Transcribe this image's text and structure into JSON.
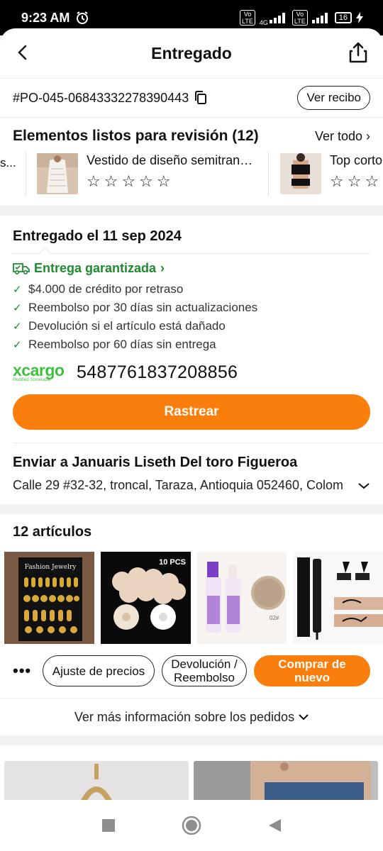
{
  "status_bar": {
    "time": "9:23 AM",
    "network": "4G",
    "lte_label": "Vo LTE",
    "battery": "16"
  },
  "header": {
    "title": "Entregado"
  },
  "order": {
    "id": "#PO-045-06843332278390443",
    "receipt_label": "Ver recibo"
  },
  "review": {
    "title": "Elementos listos para revisión (12)",
    "see_all": "Ver todo",
    "items": [
      {
        "name": "Vestido de diseño semitran…"
      },
      {
        "name": "Top corto"
      }
    ],
    "partial_left": "s..."
  },
  "delivery": {
    "title": "Entregado el 11 sep 2024",
    "guarantee": "Entrega garantizada",
    "benefits": [
      "$4.000 de crédito por retraso",
      "Reembolso por 30 días sin actualizaciones",
      "Devolución si el artículo está dañado",
      "Reembolso por 60 días sin entrega"
    ],
    "carrier_logo": "xcargo",
    "carrier_sub": "Modified Somerable",
    "tracking_number": "5487761837208856",
    "track_button": "Rastrear"
  },
  "shipping": {
    "title": "Enviar a Januaris Liseth Del toro Figueroa",
    "address": "Calle 29 #32-32, troncal, Taraza, Antioquia 052460, Colom"
  },
  "items": {
    "title": "12 artículos",
    "thumb_labels": [
      "Fashion Jewelry",
      "10 PCS"
    ],
    "actions": {
      "more": "•••",
      "price_adjust": "Ajuste de precios",
      "return_refund": "Devolución / Reembolso",
      "buy_again": "Comprar de nuevo"
    },
    "more_info": "Ver más información sobre los pedidos"
  },
  "colors": {
    "accent": "#f97e0b",
    "green": "#1e8a2e"
  }
}
